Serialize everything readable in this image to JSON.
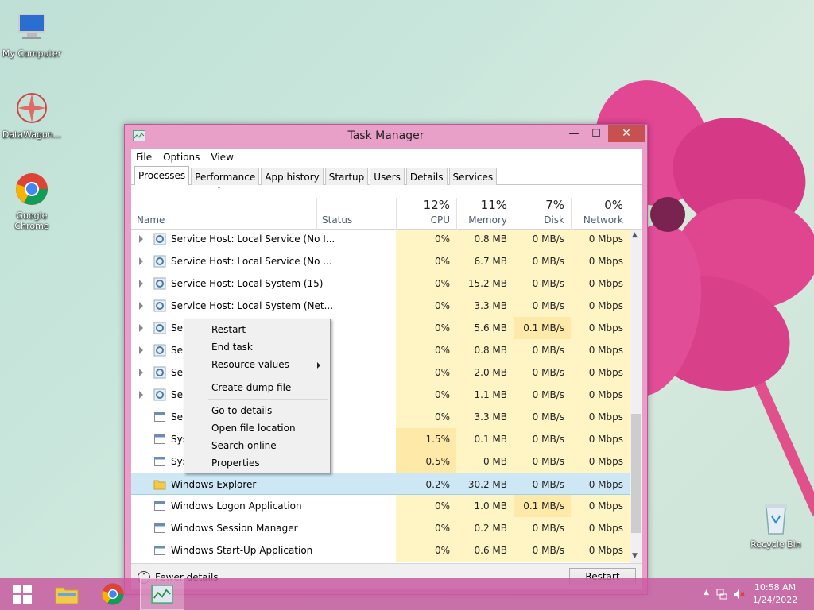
{
  "desktop": {
    "icons": [
      {
        "label": "My Computer"
      },
      {
        "label": "DataWagon..."
      },
      {
        "label": "Google Chrome"
      },
      {
        "label": "Recycle Bin"
      }
    ]
  },
  "window": {
    "title": "Task Manager",
    "controls": {
      "minimize": "—",
      "maximize": "☐",
      "close": "✕"
    },
    "menu": [
      "File",
      "Options",
      "View"
    ],
    "tabs": [
      "Processes",
      "Performance",
      "App history",
      "Startup",
      "Users",
      "Details",
      "Services"
    ],
    "active_tab": "Processes"
  },
  "header": {
    "name": "Name",
    "status": "Status",
    "cpu": {
      "pct": "12%",
      "label": "CPU"
    },
    "memory": {
      "pct": "11%",
      "label": "Memory"
    },
    "disk": {
      "pct": "7%",
      "label": "Disk"
    },
    "network": {
      "pct": "0%",
      "label": "Network"
    }
  },
  "rows": [
    {
      "name": "Service Host: Local Service (No I...",
      "cpu": "0%",
      "mem": "0.8 MB",
      "disk": "0 MB/s",
      "net": "0 Mbps",
      "expand": true
    },
    {
      "name": "Service Host: Local Service (No ...",
      "cpu": "0%",
      "mem": "6.7 MB",
      "disk": "0 MB/s",
      "net": "0 Mbps",
      "expand": true
    },
    {
      "name": "Service Host: Local System (15)",
      "cpu": "0%",
      "mem": "15.2 MB",
      "disk": "0 MB/s",
      "net": "0 Mbps",
      "expand": true
    },
    {
      "name": "Service Host: Local System (Net...",
      "cpu": "0%",
      "mem": "3.3 MB",
      "disk": "0 MB/s",
      "net": "0 Mbps",
      "expand": true
    },
    {
      "name": "Ser",
      "cpu": "0%",
      "mem": "5.6 MB",
      "disk": "0.1 MB/s",
      "net": "0 Mbps",
      "expand": true
    },
    {
      "name": "Ser",
      "cpu": "0%",
      "mem": "0.8 MB",
      "disk": "0 MB/s",
      "net": "0 Mbps",
      "expand": true
    },
    {
      "name": "Ser",
      "cpu": "0%",
      "mem": "2.0 MB",
      "disk": "0 MB/s",
      "net": "0 Mbps",
      "expand": true
    },
    {
      "name": "Ser",
      "cpu": "0%",
      "mem": "1.1 MB",
      "disk": "0 MB/s",
      "net": "0 Mbps",
      "expand": true
    },
    {
      "name": "Ser",
      "cpu": "0%",
      "mem": "3.3 MB",
      "disk": "0 MB/s",
      "net": "0 Mbps",
      "expand": false
    },
    {
      "name": "Sys",
      "cpu": "1.5%",
      "mem": "0.1 MB",
      "disk": "0 MB/s",
      "net": "0 Mbps",
      "expand": false
    },
    {
      "name": "Sys",
      "cpu": "0.5%",
      "mem": "0 MB",
      "disk": "0 MB/s",
      "net": "0 Mbps",
      "expand": false
    },
    {
      "name": "Windows Explorer",
      "cpu": "0.2%",
      "mem": "30.2 MB",
      "disk": "0 MB/s",
      "net": "0 Mbps",
      "expand": false,
      "selected": true
    },
    {
      "name": "Windows Logon Application",
      "cpu": "0%",
      "mem": "1.0 MB",
      "disk": "0.1 MB/s",
      "net": "0 Mbps",
      "expand": false
    },
    {
      "name": "Windows Session Manager",
      "cpu": "0%",
      "mem": "0.2 MB",
      "disk": "0 MB/s",
      "net": "0 Mbps",
      "expand": false
    },
    {
      "name": "Windows Start-Up Application",
      "cpu": "0%",
      "mem": "0.6 MB",
      "disk": "0 MB/s",
      "net": "0 Mbps",
      "expand": false
    }
  ],
  "context_menu": {
    "items": [
      "Restart",
      "End task",
      "Resource values",
      "Create dump file",
      "Go to details",
      "Open file location",
      "Search online",
      "Properties"
    ]
  },
  "footer": {
    "fewer_details": "Fewer details",
    "restart_button": "Restart"
  },
  "taskbar": {
    "time": "10:58 AM",
    "date": "1/24/2022"
  },
  "colors": {
    "accent": "#e8a0c8",
    "taskbar": "#c85aa0",
    "heat": "#fff4c4",
    "selection": "#cde8f4"
  }
}
